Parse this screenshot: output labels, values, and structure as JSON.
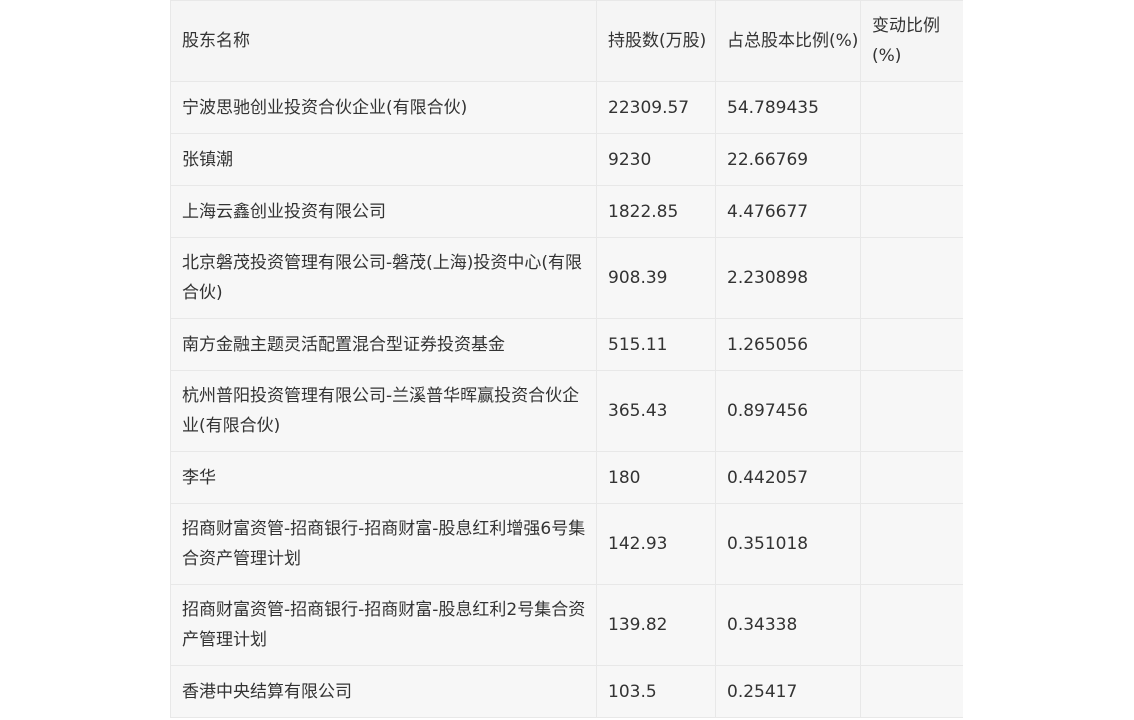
{
  "table": {
    "headers": [
      "股东名称",
      "持股数(万股)",
      "占总股本比例(%)",
      "变动比例(%)"
    ],
    "rows": [
      {
        "name": "宁波思驰创业投资合伙企业(有限合伙)",
        "shares": "22309.57",
        "ratio": "54.789435",
        "change": ""
      },
      {
        "name": "张镇潮",
        "shares": "9230",
        "ratio": "22.66769",
        "change": ""
      },
      {
        "name": "上海云鑫创业投资有限公司",
        "shares": "1822.85",
        "ratio": "4.476677",
        "change": ""
      },
      {
        "name": "北京磐茂投资管理有限公司-磐茂(上海)投资中心(有限合伙)",
        "shares": "908.39",
        "ratio": "2.230898",
        "change": ""
      },
      {
        "name": "南方金融主题灵活配置混合型证券投资基金",
        "shares": "515.11",
        "ratio": "1.265056",
        "change": ""
      },
      {
        "name": "杭州普阳投资管理有限公司-兰溪普华晖赢投资合伙企业(有限合伙)",
        "shares": "365.43",
        "ratio": "0.897456",
        "change": ""
      },
      {
        "name": "李华",
        "shares": "180",
        "ratio": "0.442057",
        "change": ""
      },
      {
        "name": "招商财富资管-招商银行-招商财富-股息红利增强6号集合资产管理计划",
        "shares": "142.93",
        "ratio": "0.351018",
        "change": ""
      },
      {
        "name": "招商财富资管-招商银行-招商财富-股息红利2号集合资产管理计划",
        "shares": "139.82",
        "ratio": "0.34338",
        "change": ""
      },
      {
        "name": "香港中央结算有限公司",
        "shares": "103.5",
        "ratio": "0.25417",
        "change": ""
      }
    ]
  }
}
